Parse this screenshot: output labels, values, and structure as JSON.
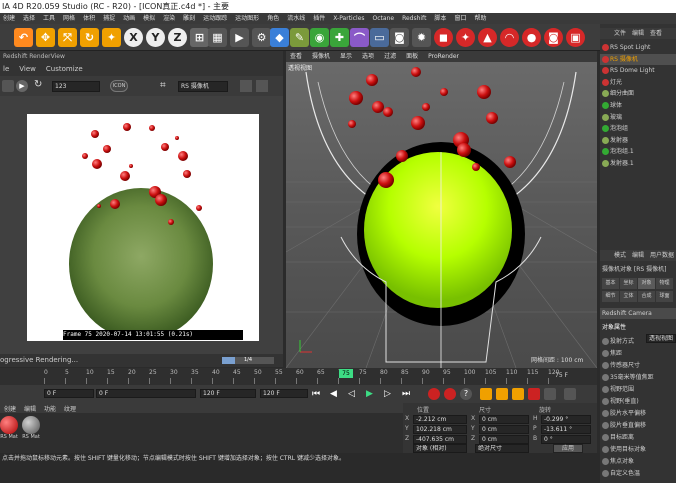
{
  "window": {
    "title": "IA 4D R20.059 Studio (RC - R20) - [ICON真正.c4d *] - 主要"
  },
  "menubar": {
    "items": [
      "创建",
      "选择",
      "工具",
      "网格",
      "体积",
      "捕捉",
      "动画",
      "模拟",
      "渲染",
      "雕刻",
      "运动跟踪",
      "运动图形",
      "角色",
      "流水线",
      "插件",
      "X-Particles",
      "Octane",
      "Redshift",
      "脚本",
      "窗口",
      "帮助"
    ]
  },
  "render_view": {
    "header": "Redshift RenderView",
    "menu": [
      "le",
      "View",
      "Customize"
    ],
    "camera_select": "123",
    "icon_label": "ICON",
    "camera_name": "RS 摄像机",
    "stamp": "Frame  75  2020-07-14  13:01:55  (0.21s)",
    "status": "ogressive Rendering...",
    "progress_value": "1/4",
    "progress_fraction": 0.25
  },
  "viewport": {
    "tabs": [
      "查看",
      "摄像机",
      "显示",
      "选项",
      "过滤",
      "面板",
      "ProRender"
    ],
    "camera_label": "透视视图",
    "grid_label": "网格间距 : 100 cm"
  },
  "right_panel": {
    "tabs": [
      "文件",
      "编辑",
      "查看"
    ],
    "objects": [
      "RS Spot Light",
      "RS 摄像机",
      "RS Dome Light",
      "灯光",
      "细分曲面",
      "球体",
      "玻璃",
      "泡泡组",
      "发射器",
      "泡泡组.1",
      "发射器.1"
    ],
    "attr_tabs": [
      "模式",
      "编辑",
      "用户数据"
    ],
    "attr_title": "摄像机对象 [RS 摄像机]",
    "attr_subtabs": [
      "基本",
      "坐标",
      "对象",
      "物理",
      "细节",
      "立体",
      "合成",
      "球面"
    ],
    "attr_extra": "Redshift Camera",
    "section": "对象属性",
    "fields": [
      "投射方式",
      "焦距",
      "传感器尺寸",
      "35毫米等值焦距",
      "视野范围",
      "视野(垂直)",
      "胶片水平偏移",
      "胶片垂直偏移",
      "目标距离",
      "使用目标对象",
      "焦点对象",
      "自定义色温"
    ],
    "projection_value": "透视视图"
  },
  "timeline": {
    "ticks": [
      "0",
      "5",
      "10",
      "15",
      "20",
      "25",
      "30",
      "35",
      "40",
      "45",
      "50",
      "55",
      "60",
      "65",
      "70",
      "75",
      "80",
      "85",
      "90",
      "95",
      "100",
      "105",
      "110",
      "115",
      "120"
    ],
    "current_frame": "75",
    "range_end": "75 F",
    "frame_start": "0 F",
    "frame_field": "0 F",
    "range_max": "120 F",
    "end_frame": "120 F"
  },
  "material": {
    "tabs": [
      "创建",
      "编辑",
      "功能",
      "纹理"
    ],
    "slots": [
      "RS Mat",
      "RS Mat"
    ]
  },
  "coords": {
    "headers": [
      "位置",
      "尺寸",
      "旋转"
    ],
    "rows": [
      {
        "axis": "X",
        "pos": "-2.212 cm",
        "size": "0 cm",
        "rot_axis": "H",
        "rot": "-0.299 °"
      },
      {
        "axis": "Y",
        "pos": "102.218 cm",
        "size": "0 cm",
        "rot_axis": "P",
        "rot": "-13.611 °"
      },
      {
        "axis": "Z",
        "pos": "-407.635 cm",
        "size": "0 cm",
        "rot_axis": "B",
        "rot": "0 °"
      }
    ],
    "mode": "对象 (相对)",
    "size_mode": "绝对尺寸",
    "apply": "应用"
  },
  "status": {
    "text": "点击并拖动鼠标移动元素。按住 SHIFT 键量化移动；节点编辑模式时按住 SHIFT 键增加选择对象；按住 CTRL 键减少选择对象。"
  },
  "colors": {
    "accent": "#f0a000",
    "bubble": "#cc1010",
    "sphere": "#b6ff00"
  }
}
